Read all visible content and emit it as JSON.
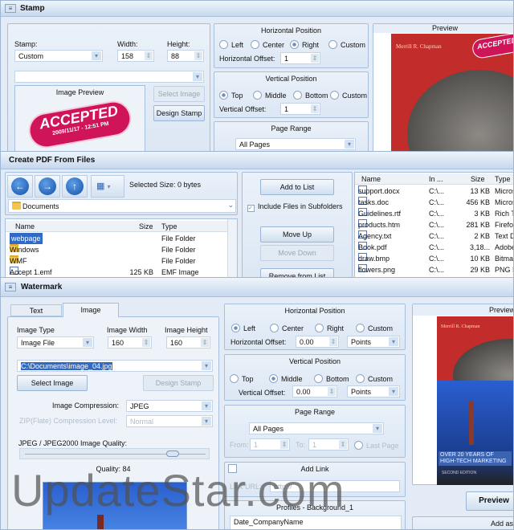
{
  "stamp_window": {
    "title": "Stamp",
    "stamp_label": "Stamp:",
    "stamp_value": "Custom",
    "width_label": "Width:",
    "width_value": "158",
    "height_label": "Height:",
    "height_value": "88",
    "image_preview_label": "Image Preview",
    "stamp_text": "ACCEPTED",
    "stamp_date": "2009/11/17 - 12:51 PM",
    "select_image": "Select Image",
    "design_stamp": "Design Stamp",
    "hpos": {
      "title": "Horizontal Position",
      "options": [
        "Left",
        "Center",
        "Right",
        "Custom"
      ],
      "selected": "Right",
      "offset_label": "Horizontal Offset:",
      "offset_value": "1"
    },
    "vpos": {
      "title": "Vertical Position",
      "options": [
        "Top",
        "Middle",
        "Bottom",
        "Custom"
      ],
      "selected": "Top",
      "offset_label": "Vertical Offset:",
      "offset_value": "1"
    },
    "page_range": {
      "title": "Page Range",
      "value": "All Pages"
    },
    "preview": {
      "title": "Preview",
      "cover_author": "Merrill R. Chapman"
    }
  },
  "pdf_window": {
    "title": "Create PDF From Files",
    "selected_size": "Selected Size: 0 bytes",
    "folder": "Documents",
    "columns": [
      "Name",
      "Size",
      "Type"
    ],
    "files": [
      {
        "name": "webpage",
        "size": "",
        "type": "File Folder",
        "icon": "folder-icon"
      },
      {
        "name": "Windows",
        "size": "",
        "type": "File Folder",
        "icon": "folder-icon"
      },
      {
        "name": "WMF",
        "size": "",
        "type": "File Folder",
        "icon": "folder-icon"
      },
      {
        "name": "Accept 1.emf",
        "size": "125 KB",
        "type": "EMF Image",
        "icon": "image-file-icon"
      }
    ],
    "add_to_list": "Add to List",
    "include_subfolders": "Include Files in Subfolders",
    "move_up": "Move Up",
    "move_down": "Move Down",
    "remove_from_list": "Remove from List",
    "list_columns": [
      "Name",
      "In ...",
      "Size",
      "Type"
    ],
    "list": [
      {
        "name": "support.docx",
        "in": "C:\\...",
        "size": "13 KB",
        "type": "Micros"
      },
      {
        "name": "tasks.doc",
        "in": "C:\\...",
        "size": "456 KB",
        "type": "Micros"
      },
      {
        "name": "Guidelines.rtf",
        "in": "C:\\...",
        "size": "3 KB",
        "type": "Rich Te"
      },
      {
        "name": "products.htm",
        "in": "C:\\...",
        "size": "281 KB",
        "type": "Firefox"
      },
      {
        "name": "Agency.txt",
        "in": "C:\\...",
        "size": "2 KB",
        "type": "Text D"
      },
      {
        "name": "Book.pdf",
        "in": "C:\\...",
        "size": "3,18...",
        "type": "Adobe"
      },
      {
        "name": "draw.bmp",
        "in": "C:\\...",
        "size": "10 KB",
        "type": "Bitmap"
      },
      {
        "name": "flowers.png",
        "in": "C:\\...",
        "size": "29 KB",
        "type": "PNG In"
      }
    ]
  },
  "watermark_window": {
    "title": "Watermark",
    "tabs": [
      "Text",
      "Image"
    ],
    "active_tab": "Image",
    "image_type_label": "Image Type",
    "image_type_value": "Image File",
    "image_width_label": "Image Width",
    "image_width_value": "160",
    "image_height_label": "Image Height",
    "image_height_value": "160",
    "path": "C:\\Documents\\image_04.jpg",
    "select_image": "Select Image",
    "design_stamp": "Design Stamp",
    "compression_label": "Image Compression:",
    "compression_value": "JPEG",
    "zip_label": "ZIP(Flate) Compression Level:",
    "zip_value": "Normal",
    "quality_label": "JPEG / JPEG2000 Image Quality:",
    "quality_text": "Quality: 84",
    "quality_value": 84,
    "hpos": {
      "title": "Horizontal Position",
      "options": [
        "Left",
        "Center",
        "Right",
        "Custom"
      ],
      "selected": "Left",
      "offset_label": "Horizontal Offset:",
      "offset_value": "0.00",
      "unit": "Points"
    },
    "vpos": {
      "title": "Vertical Position",
      "options": [
        "Top",
        "Middle",
        "Bottom",
        "Custom"
      ],
      "selected": "Middle",
      "offset_label": "Vertical Offset:",
      "offset_value": "0.00",
      "unit": "Points"
    },
    "page_range": {
      "title": "Page Range",
      "value": "All Pages",
      "from_label": "From:",
      "from_value": "1",
      "to_label": "To:",
      "to_value": "1",
      "last_page": "Last Page"
    },
    "add_link": {
      "title": "Add Link",
      "url_label": "Link URL:",
      "url_value": "http://"
    },
    "profiles": {
      "title": "Profiles - Background_1",
      "items": [
        "Date_CompanyName"
      ]
    },
    "preview": {
      "title": "Preview",
      "button": "Preview",
      "add_as": "Add as",
      "cover_author": "Merrill R. Chapman",
      "cover_tagline": "OVER 20 YEARS OF HIGH-TECH MARKETING",
      "cover_edition": "SECOND EDITION"
    }
  },
  "overlay_watermark": "UpdateStar.com",
  "colors": {
    "accent": "#c6d8ee",
    "stamp_pink": "#d0145a",
    "selection": "#316ac5"
  }
}
